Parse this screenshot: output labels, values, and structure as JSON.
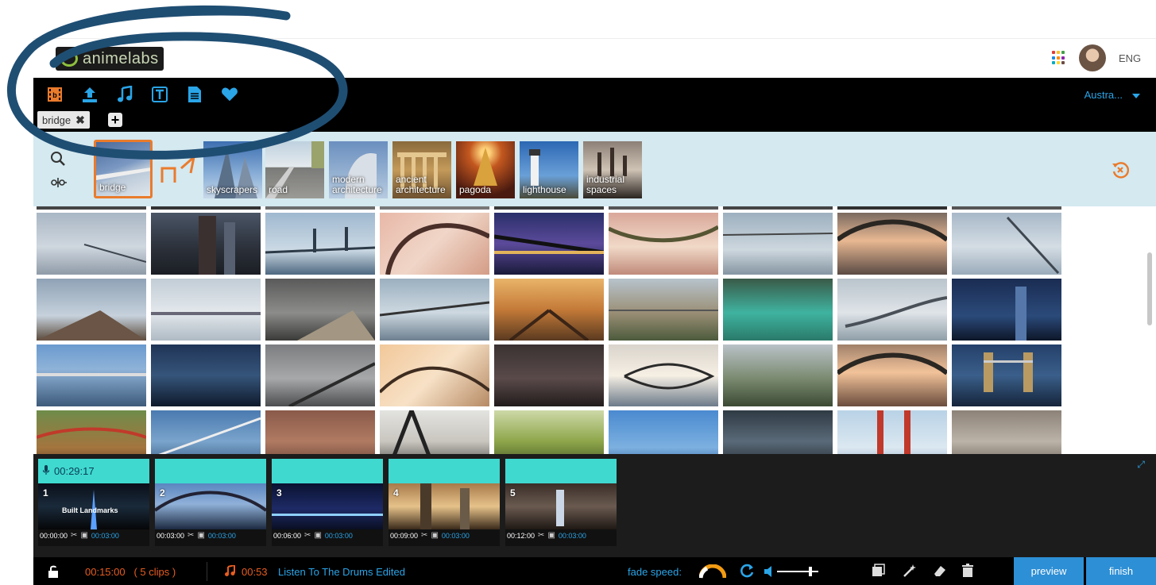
{
  "header": {
    "logo_text": "animelabs",
    "language": "ENG"
  },
  "toolbar": {
    "icons": [
      "video-icon",
      "upload-icon",
      "music-icon",
      "text-icon",
      "document-icon",
      "heart-icon"
    ],
    "region": "Austra...",
    "tab_label": "bridge",
    "tab_close": "✖",
    "add_tab": "+"
  },
  "categories": [
    {
      "label": "bridge",
      "selected": true
    },
    {
      "label": "",
      "selected": false
    },
    {
      "label": "skyscrapers",
      "selected": false
    },
    {
      "label": "road",
      "selected": false
    },
    {
      "label": "modern\narchitecture",
      "selected": false
    },
    {
      "label": "ancient\narchitecture",
      "selected": false
    },
    {
      "label": "pagoda",
      "selected": false
    },
    {
      "label": "lighthouse",
      "selected": false
    },
    {
      "label": "industrial\nspaces",
      "selected": false
    }
  ],
  "timeline": {
    "voice_time": "00:29:17",
    "clips": [
      {
        "number": "1",
        "caption": "Built Landmarks",
        "start": "00:00:00",
        "duration": "00:03:00"
      },
      {
        "number": "2",
        "caption": "",
        "start": "00:03:00",
        "duration": "00:03:00"
      },
      {
        "number": "3",
        "caption": "",
        "start": "00:06:00",
        "duration": "00:03:00"
      },
      {
        "number": "4",
        "caption": "",
        "start": "00:09:00",
        "duration": "00:03:00"
      },
      {
        "number": "5",
        "caption": "",
        "start": "00:12:00",
        "duration": "00:03:00"
      }
    ]
  },
  "bottombar": {
    "total_time": "00:15:00",
    "clip_count": "( 5 clips )",
    "music_time": "00:53",
    "music_title": "Listen To The Drums Edited",
    "fade_label": "fade speed:",
    "preview_label": "preview",
    "finish_label": "finish"
  },
  "colors": {
    "accent_blue": "#2aa5e8",
    "accent_orange": "#ea7b2c",
    "clip_header": "#3fd9d0",
    "strip_bg": "#d4e9f0"
  }
}
